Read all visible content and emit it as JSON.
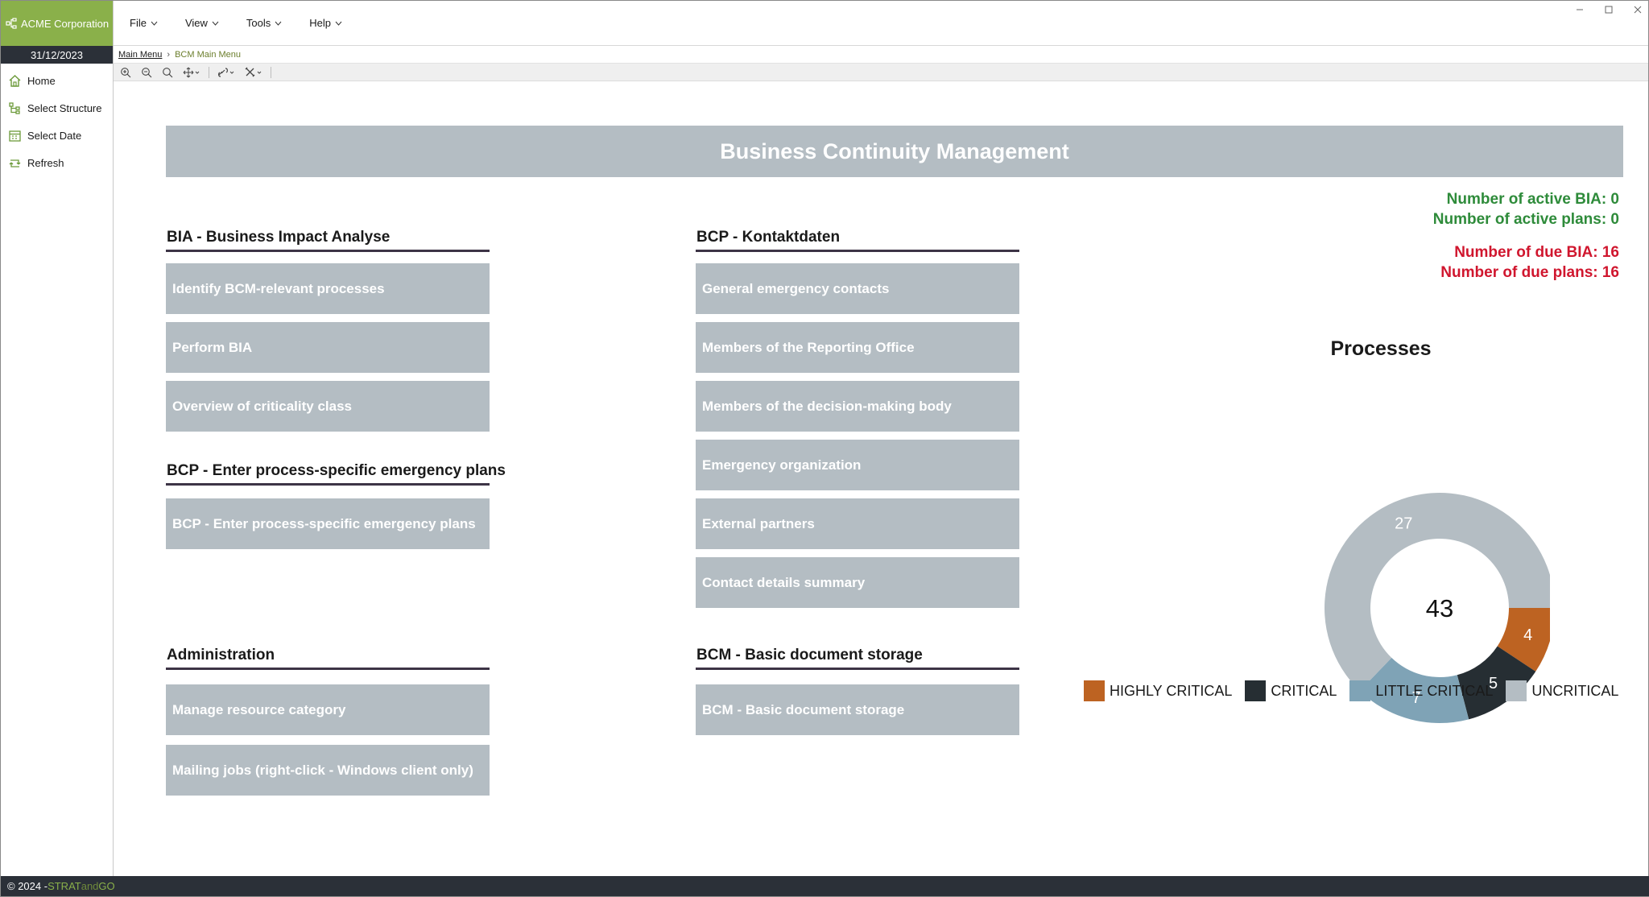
{
  "app": {
    "brand": "ACME Corporation",
    "date": "31/12/2023"
  },
  "sidebar": {
    "items": [
      {
        "label": "Home",
        "icon": "home-icon"
      },
      {
        "label": "Select Structure",
        "icon": "structure-icon"
      },
      {
        "label": "Select Date",
        "icon": "calendar-icon"
      },
      {
        "label": "Refresh",
        "icon": "refresh-icon"
      }
    ]
  },
  "menu": {
    "items": [
      {
        "label": "File"
      },
      {
        "label": "View"
      },
      {
        "label": "Tools"
      },
      {
        "label": "Help"
      }
    ]
  },
  "breadcrumb": {
    "root": "Main Menu",
    "current": "BCM Main Menu"
  },
  "toolbar": {
    "icons": [
      "zoom-in-icon",
      "zoom-out-icon",
      "zoom-reset-icon",
      "pan-icon",
      "link-icon",
      "tools-icon"
    ]
  },
  "main": {
    "title": "Business Continuity Management",
    "sections": {
      "bia": {
        "heading": "BIA - Business Impact Analyse",
        "tiles": [
          "Identify BCM-relevant processes",
          "Perform BIA",
          "Overview of criticality class"
        ]
      },
      "bcp_plans": {
        "heading": "BCP - Enter process-specific emergency plans",
        "tiles": [
          "BCP - Enter process-specific emergency plans"
        ]
      },
      "admin": {
        "heading": "Administration",
        "tiles": [
          "Manage resource category",
          "Mailing jobs (right-click - Windows client only)"
        ]
      },
      "contacts": {
        "heading": "BCP - Kontaktdaten",
        "tiles": [
          "General emergency contacts",
          "Members of the Reporting Office",
          "Members of the decision-making body",
          "Emergency organization",
          "External partners",
          "Contact details summary"
        ]
      },
      "docs": {
        "heading": "BCM - Basic document storage",
        "tiles": [
          "BCM - Basic document storage"
        ]
      }
    },
    "stats": {
      "active_bia": "Number of active BIA: 0",
      "active_plans": "Number of active plans: 0",
      "due_bia": "Number of due BIA: 16",
      "due_plans": "Number of due plans: 16"
    }
  },
  "chart_data": {
    "type": "pie",
    "title": "Processes",
    "total": "43",
    "categories": [
      "HIGHLY CRITICAL",
      "CRITICAL",
      "LITTLE CRITICAL",
      "UNCRITICAL"
    ],
    "values": [
      4,
      5,
      7,
      27
    ],
    "colors": [
      "#bd6322",
      "#262e33",
      "#7fa3b6",
      "#b4bdc3"
    ],
    "legend": "bottom"
  },
  "footer": {
    "copyright": "© 2024 - ",
    "brand_strat": "STRAT",
    "brand_and": "and",
    "brand_go": "GO"
  }
}
